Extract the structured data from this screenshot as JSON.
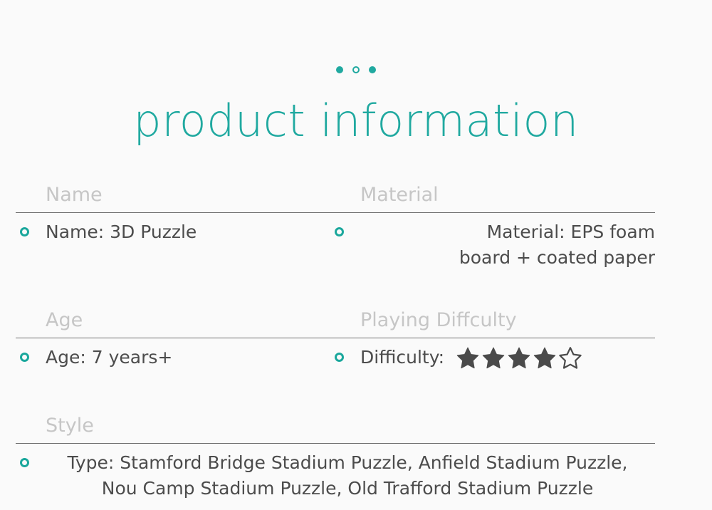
{
  "page": {
    "background": "#fafafa",
    "accent": "#20a9a0",
    "label_color": "#c6c6c6",
    "value_color": "#4c4c4c",
    "divider_color": "#6f6f6f",
    "star_color": "#4a4a4a"
  },
  "header": {
    "title": "product information",
    "dots": [
      {
        "name": "dot-1",
        "style": "filled"
      },
      {
        "name": "dot-2",
        "style": "hollow"
      },
      {
        "name": "dot-3",
        "style": "filled"
      }
    ]
  },
  "specs": {
    "row1": {
      "left": {
        "label": "Name",
        "value": "Name: 3D Puzzle"
      },
      "right": {
        "label": "Material",
        "value_line1": "Material: EPS foam",
        "value_line2": "board + coated paper"
      }
    },
    "row2": {
      "left": {
        "label": "Age",
        "value": "Age: 7 years+"
      },
      "right": {
        "label": "Playing Diffculty",
        "value_prefix": "Difficulty:",
        "rating_filled": 4,
        "rating_total": 5
      }
    },
    "row3": {
      "label": "Style",
      "value_line1": "Type: Stamford Bridge Stadium Puzzle, Anfield Stadium Puzzle,",
      "value_line2": "Nou Camp Stadium Puzzle, Old Trafford Stadium Puzzle"
    }
  }
}
